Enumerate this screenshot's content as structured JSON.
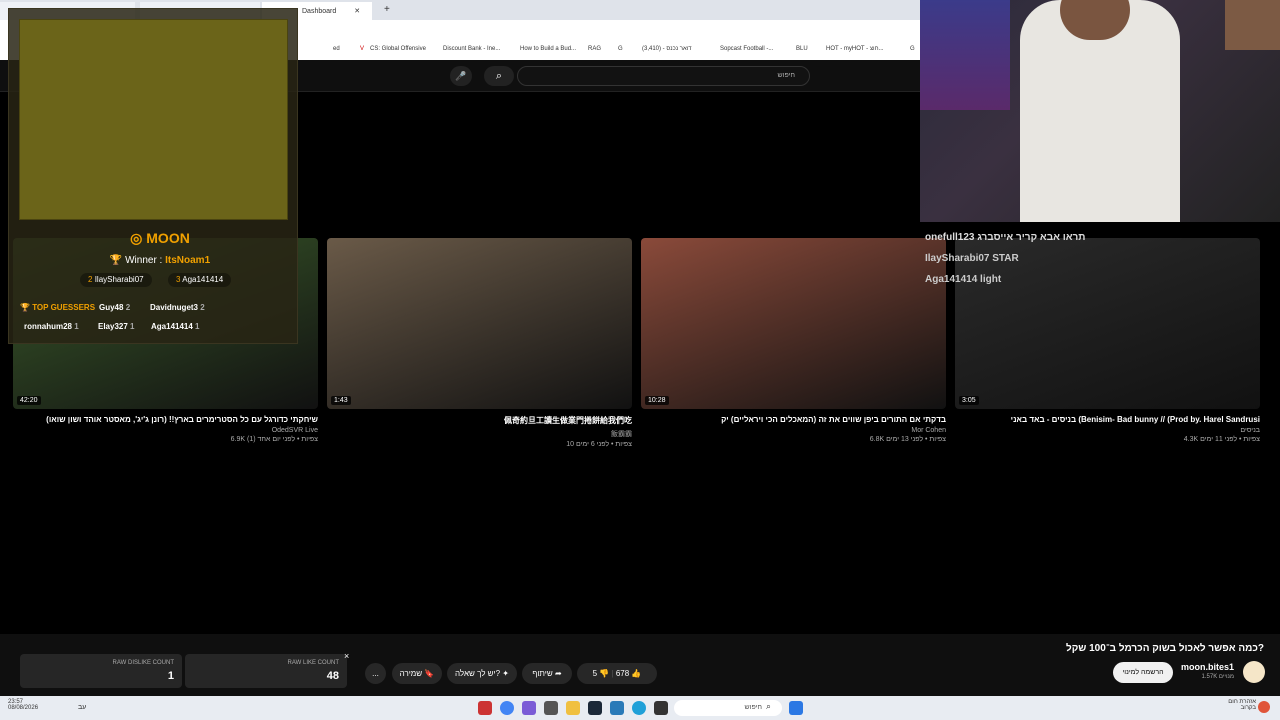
{
  "browser": {
    "tabs": [
      "Dashboard",
      "+"
    ],
    "bookmarks": [
      "ed",
      "CS: Global Offensive",
      "Discount Bank - Ine...",
      "How to Build a Bud...",
      "RAG",
      "G",
      "(3,410) - דואר נכנס",
      "Sopcast Football -...",
      "BLU",
      "HOT - myHOT - חוצ...",
      "G"
    ]
  },
  "youtube": {
    "search_placeholder": "חיפוש",
    "videos": [
      {
        "title": "שיחקתי כדורגל עם כל הסטרימרים בארץ!! (רונן ג'יג', מאסטר אוהד ושון שואו)",
        "channel": "OdedSVR Live",
        "stats": "6.9K צפיות • לפני יום אחד (1)",
        "duration": "42:20",
        "color": "#3a5a2a"
      },
      {
        "title": "佩奇約旦工讀生做業門捲餅給我們吃",
        "channel": "飯霸霸",
        "stats": "10 צפיות • לפני 6 ימים",
        "duration": "1:43",
        "color": "#6a5a48"
      },
      {
        "title": "בדקתי אם התורים ביפן שווים את זה (המאכלים הכי ויראליים) יק",
        "channel": "Mor Cohen",
        "stats": "6.8K צפיות • לפני 13 ימים",
        "duration": "10:28",
        "color": "#8a4a3a"
      },
      {
        "title": "בניסים - באד באני (Benisim- Bad bunny // (Prod by. Harel Sandrusi",
        "channel": "בניסים",
        "stats": "4.3K צפיות • לפני 11 ימים",
        "duration": "3:05",
        "color": "#2a2a2a"
      }
    ],
    "now_playing": {
      "title": "כמה אפשר לאכול בשוק הכרמל ב־100 שקל?",
      "channel": "moon.bites1",
      "subs": "1.57K מנויים",
      "subscribe": "הרשמה למינוי",
      "likes": "678",
      "dislikes": "5",
      "share": "שיתוף",
      "ask": "יש לך שאלה?",
      "save": "שמירה",
      "more": "..."
    }
  },
  "dislike_ext": {
    "dislike_label": "RAW DISLIKE COUNT",
    "dislike_value": "1",
    "like_label": "RAW LIKE COUNT",
    "like_value": "48",
    "close": "×"
  },
  "game_overlay": {
    "title": "MOON",
    "winner_label": "Winner :",
    "winner": "ItsNoam1",
    "places": [
      {
        "rank": "2",
        "name": "IlaySharabi07"
      },
      {
        "rank": "3",
        "name": "Aga141414"
      }
    ],
    "top_guessers_label": "TOP GUESSERS",
    "guessers": [
      {
        "name": "Guy48",
        "score": "2"
      },
      {
        "name": "Davidnuget3",
        "score": "2"
      },
      {
        "name": "ronnahum28",
        "score": "1"
      },
      {
        "name": "Elay327",
        "score": "1"
      },
      {
        "name": "Aga141414",
        "score": "1"
      }
    ]
  },
  "chat_overlay": [
    "onefull123 תראו אבא קריר אייסברג",
    "IlaySharabi07 STAR",
    "Aga141414 light"
  ],
  "taskbar": {
    "time": "23:57",
    "date": "08/08/2026",
    "search": "חיפוש",
    "lang": "עב",
    "weather": "אזהרת חום",
    "weather_sub": "בקרוב"
  }
}
